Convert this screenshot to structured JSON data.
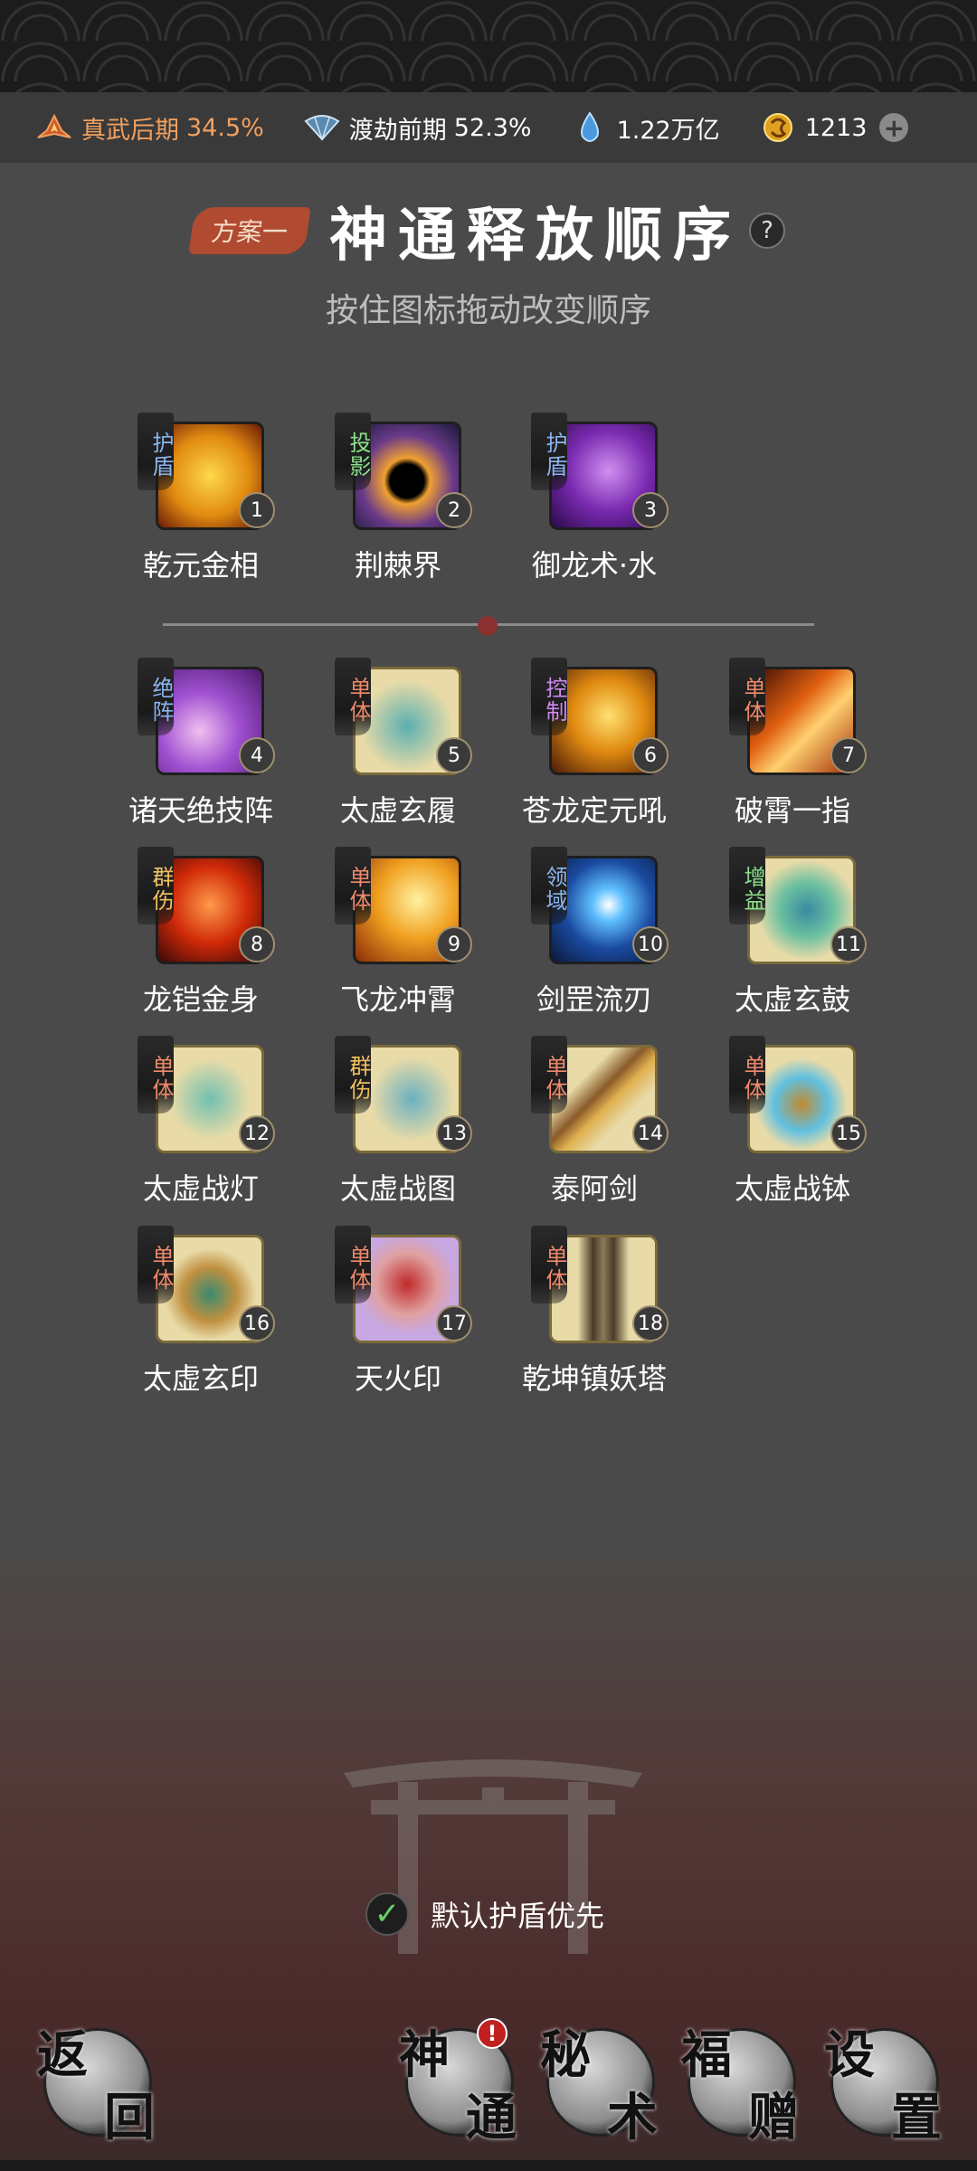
{
  "status_bar": {
    "realm": {
      "label": "真武后期",
      "value": "34.5%",
      "icon": "flame-lotus-icon"
    },
    "tribulation": {
      "label": "渡劫前期",
      "value": "52.3%",
      "icon": "fan-icon"
    },
    "spirit_water": {
      "value": "1.22万亿",
      "icon": "water-drop-icon"
    },
    "coins": {
      "value": "1213",
      "icon": "coin-icon"
    },
    "plus_label": "+"
  },
  "header": {
    "scheme_label": "方案一",
    "title": "神通释放顺序",
    "help_label": "?",
    "subtitle": "按住图标拖动改变顺序"
  },
  "skills_top": [
    {
      "name": "乾元金相",
      "tag": "护盾",
      "tag_color": "#8ab4f0",
      "num": "1",
      "bg": "radial-gradient(circle at 50% 50%, #ffd84a, #e08a10 55%, #6a1a08)",
      "light": false
    },
    {
      "name": "荆棘界",
      "tag": "投影",
      "tag_color": "#8ae08a",
      "num": "2",
      "bg": "radial-gradient(circle at 50% 55%, #000 22%, #f0a030 30%, #6a3a8a 60%, #1a1a3a)",
      "light": false
    },
    {
      "name": "御龙术·水",
      "tag": "护盾",
      "tag_color": "#8ab4f0",
      "num": "3",
      "bg": "radial-gradient(circle at 55% 45%, #d090f0, #7a2ab0 50%, #2a0a4a)",
      "light": false
    }
  ],
  "skills_main": [
    {
      "name": "诸天绝技阵",
      "tag": "绝阵",
      "tag_color": "#8ab4f0",
      "num": "4",
      "bg": "radial-gradient(circle at 40% 60%, #f0c0f0, #a050d0 45%, #4a1a6a)",
      "light": false
    },
    {
      "name": "太虚玄履",
      "tag": "单体",
      "tag_color": "#f08a6a",
      "num": "5",
      "bg": "radial-gradient(circle at 50% 55%, #5ab0b0, #e8dba8 60%)",
      "light": true
    },
    {
      "name": "苍龙定元吼",
      "tag": "控制",
      "tag_color": "#d08af0",
      "num": "6",
      "bg": "radial-gradient(circle at 55% 45%, #ffe070, #e08a10 45%, #4a1a08)",
      "light": false
    },
    {
      "name": "破霄一指",
      "tag": "单体",
      "tag_color": "#f08a6a",
      "num": "7",
      "bg": "linear-gradient(135deg, #3a0a04, #e06010 40%, #ffd070 60%, #a02a08)",
      "light": false
    },
    {
      "name": "龙铠金身",
      "tag": "群伤",
      "tag_color": "#f0c060",
      "num": "8",
      "bg": "radial-gradient(circle at 50% 45%, #ff9a4a, #d02a08 50%, #3a0808)",
      "light": false
    },
    {
      "name": "飞龙冲霄",
      "tag": "单体",
      "tag_color": "#f08a6a",
      "num": "9",
      "bg": "radial-gradient(circle at 60% 40%, #fff2a0, #f0a020 45%, #8a2a08)",
      "light": false
    },
    {
      "name": "剑罡流刃",
      "tag": "领域",
      "tag_color": "#8ab4f0",
      "num": "10",
      "bg": "radial-gradient(circle at 55% 45%, #ffffff, #60c0ff 20%, #1a4aa0 55%, #0a1a3a)",
      "light": false
    },
    {
      "name": "太虚玄鼓",
      "tag": "增益",
      "tag_color": "#8ae08a",
      "num": "11",
      "bg": "radial-gradient(circle at 55% 50%, #3a8aa0, #6ac0a0 35%, #e8dba8 65%)",
      "light": true
    },
    {
      "name": "太虚战灯",
      "tag": "单体",
      "tag_color": "#f08a6a",
      "num": "12",
      "bg": "radial-gradient(circle at 50% 50%, #70c0b0, #e8dba8 55%)",
      "light": true
    },
    {
      "name": "太虚战图",
      "tag": "群伤",
      "tag_color": "#f0c060",
      "num": "13",
      "bg": "radial-gradient(circle at 55% 50%, #6ab0c0, #e8dba8 55%)",
      "light": true
    },
    {
      "name": "泰阿剑",
      "tag": "单体",
      "tag_color": "#f08a6a",
      "num": "14",
      "bg": "linear-gradient(135deg, #e8dba8 30%, #8a5a2a 45%, #e0b050 55%, #e8dba8 70%)",
      "light": true
    },
    {
      "name": "太虚战钵",
      "tag": "单体",
      "tag_color": "#f08a6a",
      "num": "15",
      "bg": "radial-gradient(circle at 50% 55%, #c08a30, #60c0e0 35%, #e8dba8 60%)",
      "light": true
    },
    {
      "name": "太虚玄印",
      "tag": "单体",
      "tag_color": "#f08a6a",
      "num": "16",
      "bg": "radial-gradient(circle at 50% 55%, #3a8a70, #c09040 35%, #e8dba8 60%)",
      "light": true
    },
    {
      "name": "天火印",
      "tag": "单体",
      "tag_color": "#f08a6a",
      "num": "17",
      "bg": "radial-gradient(circle at 50% 45%, #c02a2a, #e0a0a0 40%, #c8a8e0 65%)",
      "light": true
    },
    {
      "name": "乾坤镇妖塔",
      "tag": "单体",
      "tag_color": "#f08a6a",
      "num": "18",
      "bg": "linear-gradient(90deg, #e8dba8 25%, #4a3a2a 40%, #8a7a5a 50%, #4a3a2a 60%, #e8dba8 75%)",
      "light": true
    }
  ],
  "options": {
    "shield_priority_label": "默认护盾优先",
    "shield_priority_checked": "✓"
  },
  "bottom_nav": {
    "back": [
      "返",
      "回"
    ],
    "divine": [
      "神",
      "通"
    ],
    "divine_alert": "!",
    "secret": [
      "秘",
      "术"
    ],
    "gift": [
      "福",
      "赠"
    ],
    "settings": [
      "设",
      "置"
    ]
  }
}
